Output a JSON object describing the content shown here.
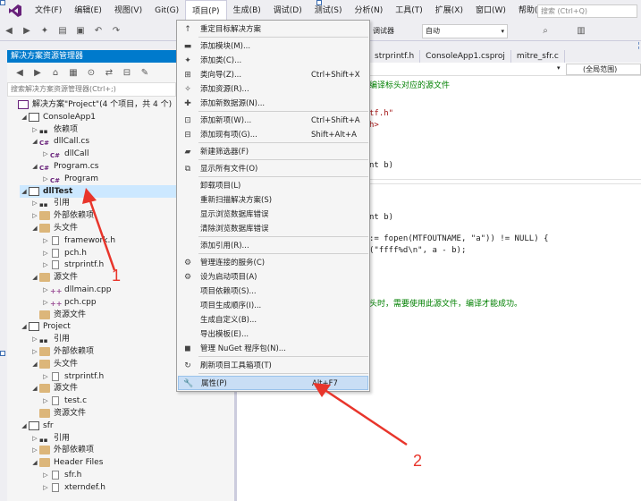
{
  "menubar": {
    "items": [
      "文件(F)",
      "编辑(E)",
      "视图(V)",
      "Git(G)",
      "项目(P)",
      "生成(B)",
      "调试(D)",
      "测试(S)",
      "分析(N)",
      "工具(T)",
      "扩展(X)",
      "窗口(W)",
      "帮助(H)"
    ],
    "search_placeholder": "搜索 (Ctrl+Q)"
  },
  "toolbar": {
    "debugger_label": "调试器",
    "config_value": "自动"
  },
  "solution_explorer": {
    "title": "解决方案资源管理器",
    "search_placeholder": "搜索解决方案资源管理器(Ctrl+;)",
    "rows": [
      {
        "label": "解决方案\"Project\"(4 个项目，共 4 个)",
        "level": 0,
        "caret": "",
        "icon": "sol"
      },
      {
        "label": "ConsoleApp1",
        "level": 1,
        "caret": "◢",
        "icon": "proj"
      },
      {
        "label": "依赖项",
        "level": 2,
        "caret": "▷",
        "icon": "ref"
      },
      {
        "label": "dllCall.cs",
        "level": 2,
        "caret": "◢",
        "icon": "cs"
      },
      {
        "label": "dllCall",
        "level": 3,
        "caret": "▷",
        "icon": "cs"
      },
      {
        "label": "Program.cs",
        "level": 2,
        "caret": "◢",
        "icon": "cs"
      },
      {
        "label": "Program",
        "level": 3,
        "caret": "▷",
        "icon": "cs"
      },
      {
        "label": "dllTest",
        "level": 1,
        "caret": "◢",
        "icon": "proj",
        "selected": true
      },
      {
        "label": "引用",
        "level": 2,
        "caret": "▷",
        "icon": "ref"
      },
      {
        "label": "外部依赖项",
        "level": 2,
        "caret": "▷",
        "icon": "folder"
      },
      {
        "label": "头文件",
        "level": 2,
        "caret": "◢",
        "icon": "folder"
      },
      {
        "label": "framework.h",
        "level": 3,
        "caret": "▷",
        "icon": "file"
      },
      {
        "label": "pch.h",
        "level": 3,
        "caret": "▷",
        "icon": "file"
      },
      {
        "label": "strprintf.h",
        "level": 3,
        "caret": "▷",
        "icon": "file"
      },
      {
        "label": "源文件",
        "level": 2,
        "caret": "◢",
        "icon": "folder"
      },
      {
        "label": "dllmain.cpp",
        "level": 3,
        "caret": "▷",
        "icon": "cpp"
      },
      {
        "label": "pch.cpp",
        "level": 3,
        "caret": "▷",
        "icon": "cpp"
      },
      {
        "label": "资源文件",
        "level": 2,
        "caret": "",
        "icon": "folder"
      },
      {
        "label": "Project",
        "level": 1,
        "caret": "◢",
        "icon": "proj"
      },
      {
        "label": "引用",
        "level": 2,
        "caret": "▷",
        "icon": "ref"
      },
      {
        "label": "外部依赖项",
        "level": 2,
        "caret": "▷",
        "icon": "folder"
      },
      {
        "label": "头文件",
        "level": 2,
        "caret": "◢",
        "icon": "folder"
      },
      {
        "label": "strprintf.h",
        "level": 3,
        "caret": "▷",
        "icon": "file"
      },
      {
        "label": "源文件",
        "level": 2,
        "caret": "◢",
        "icon": "folder"
      },
      {
        "label": "test.c",
        "level": 3,
        "caret": "▷",
        "icon": "file"
      },
      {
        "label": "资源文件",
        "level": 2,
        "caret": "",
        "icon": "folder"
      },
      {
        "label": "sfr",
        "level": 1,
        "caret": "◢",
        "icon": "proj"
      },
      {
        "label": "引用",
        "level": 2,
        "caret": "▷",
        "icon": "ref"
      },
      {
        "label": "外部依赖项",
        "level": 2,
        "caret": "▷",
        "icon": "folder"
      },
      {
        "label": "Header Files",
        "level": 2,
        "caret": "◢",
        "icon": "folder"
      },
      {
        "label": "sfr.h",
        "level": 3,
        "caret": "▷",
        "icon": "file"
      },
      {
        "label": "xterndef.h",
        "level": 3,
        "caret": "▷",
        "icon": "file"
      }
    ]
  },
  "editor": {
    "tabs": [
      "strprintf.h",
      "ConsoleApp1.csproj",
      "mitre_sfr.c"
    ],
    "scope": "(全局范围)",
    "lines": [
      {
        "text": "编译标头对应的源文件",
        "cls": "c-comment"
      },
      {
        "text": "tf.h\"",
        "cls": "c-str"
      },
      {
        "text": "h>",
        "cls": "c-str"
      },
      {
        "text": "nt b)",
        "cls": ""
      },
      {
        "text": "nt b)",
        "cls": ""
      },
      {
        "text": ":= fopen(MTFOUTNAME, \"a\")) != NULL) {",
        "cls": ""
      },
      {
        "text": "(\"ffff%d\\n\", a - b);",
        "cls": ""
      },
      {
        "text": "头时，需要使用此源文件，编译才能成功。",
        "cls": "c-comment"
      }
    ]
  },
  "context_menu": {
    "items": [
      {
        "label": "重定目标解决方案",
        "shortcut": "",
        "icon": "↑"
      },
      {
        "label": "添加模块(M)...",
        "shortcut": "",
        "icon": "▬"
      },
      {
        "label": "添加类(C)...",
        "shortcut": "",
        "icon": "✦"
      },
      {
        "label": "类向导(Z)...",
        "shortcut": "Ctrl+Shift+X",
        "icon": "⊞"
      },
      {
        "label": "添加资源(R)...",
        "shortcut": "",
        "icon": "✧"
      },
      {
        "label": "添加新数据源(N)...",
        "shortcut": "",
        "icon": "✚"
      },
      {
        "label": "添加新项(W)...",
        "shortcut": "Ctrl+Shift+A",
        "icon": "⊡"
      },
      {
        "label": "添加现有项(G)...",
        "shortcut": "Shift+Alt+A",
        "icon": "⊟"
      },
      {
        "label": "新建筛选器(F)",
        "shortcut": "",
        "icon": "▰"
      },
      {
        "label": "显示所有文件(O)",
        "shortcut": "",
        "icon": "⧉"
      },
      {
        "label": "卸载项目(L)",
        "shortcut": "",
        "icon": ""
      },
      {
        "label": "重新扫描解决方案(S)",
        "shortcut": "",
        "icon": ""
      },
      {
        "label": "显示浏览数据库错误",
        "shortcut": "",
        "icon": ""
      },
      {
        "label": "清除浏览数据库错误",
        "shortcut": "",
        "icon": ""
      },
      {
        "label": "添加引用(R)...",
        "shortcut": "",
        "icon": ""
      },
      {
        "label": "管理连接的服务(C)",
        "shortcut": "",
        "icon": "⚙"
      },
      {
        "label": "设为启动项目(A)",
        "shortcut": "",
        "icon": "⚙"
      },
      {
        "label": "项目依赖项(S)...",
        "shortcut": "",
        "icon": ""
      },
      {
        "label": "项目生成顺序(I)...",
        "shortcut": "",
        "icon": ""
      },
      {
        "label": "生成自定义(B)...",
        "shortcut": "",
        "icon": ""
      },
      {
        "label": "导出模板(E)...",
        "shortcut": "",
        "icon": ""
      },
      {
        "label": "管理 NuGet 程序包(N)...",
        "shortcut": "",
        "icon": "◼"
      },
      {
        "label": "刷新项目工具箱项(T)",
        "shortcut": "",
        "icon": "↻"
      },
      {
        "label": "属性(P)",
        "shortcut": "Alt+F7",
        "icon": "🔧",
        "highlight": true
      }
    ]
  },
  "annotations": {
    "label1": "1",
    "label2": "2",
    "color": "#e8352b"
  }
}
